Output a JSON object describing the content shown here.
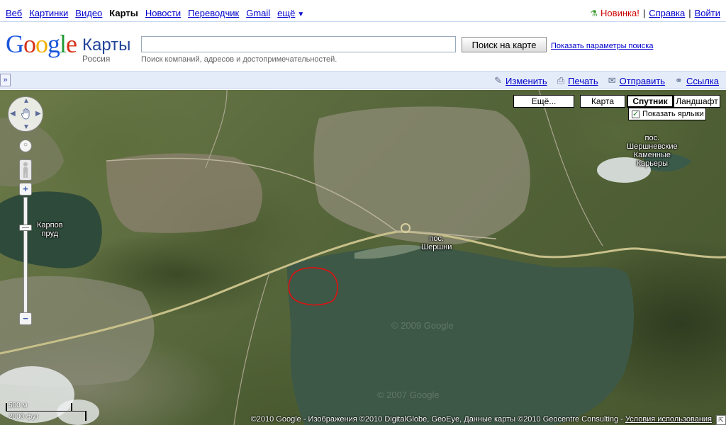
{
  "topnav": {
    "items": [
      "Веб",
      "Картинки",
      "Видео",
      "Карты",
      "Новости",
      "Переводчик",
      "Gmail",
      "ещё"
    ],
    "active_index": 3
  },
  "topright": {
    "new_label": "Новинка!",
    "help_label": "Справка",
    "signin_label": "Войти"
  },
  "header": {
    "logo_google": "Google",
    "logo_maps": "Карты",
    "logo_region": "Россия",
    "search_value": "",
    "search_button": "Поиск на карте",
    "search_options": "Показать параметры поиска",
    "search_hint": "Поиск компаний, адресов и достопримечательностей."
  },
  "toolbar": {
    "toggle_glyph": "»",
    "edit_label": "Изменить",
    "print_label": "Печать",
    "send_label": "Отправить",
    "link_label": "Ссылка"
  },
  "map": {
    "type_buttons": {
      "more": "Ещё...",
      "map": "Карта",
      "satellite": "Спутник",
      "terrain": "Ландшафт"
    },
    "show_labels": "Показать ярлыки",
    "show_labels_checked": true,
    "place_labels": {
      "karpov": "Карпов\nпруд",
      "shershni": "пос.\nШершни",
      "karery": "пос.\nШершневские\nКаменные\nКарьеры"
    },
    "scale_metric": "500 м",
    "scale_imperial": "2000 фут",
    "copyright": "©2010 Google - Изображения ©2010 DigitalGlobe, GeoEye, Данные карты ©2010 Geocentre Consulting - ",
    "terms_label": "Условия использования",
    "watermark_1": "© 2009 Google",
    "watermark_2": "© 2007 Google"
  },
  "colors": {
    "link": "#0000cc",
    "toolbar_bg": "#e5ecf9",
    "water": "#3f5a4a",
    "highlight": "#e01010"
  }
}
